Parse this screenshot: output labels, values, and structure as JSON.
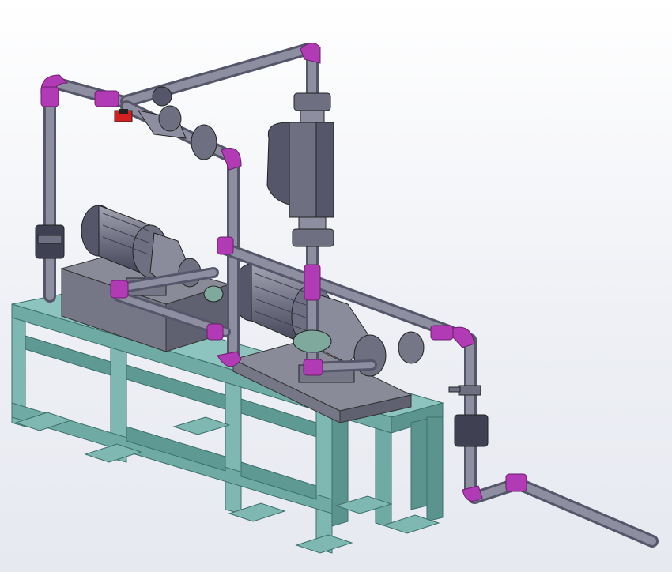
{
  "scene": {
    "colors": {
      "background_top": "#ffffff",
      "background_bottom": "#e6e9f0",
      "frame": "#7fb7b2",
      "frame_shade": "#5e9994",
      "frame_dark": "#4a807b",
      "steel": "#7e7f8e",
      "steel_dark": "#55566a",
      "steel_light": "#a4a5b4",
      "fitting": "#b13ab5",
      "fitting_light": "#d068d3",
      "valve_red": "#d42020"
    },
    "components": [
      "skid-frame",
      "mounting-plate-left",
      "mounting-plate-right",
      "pump-motor-left",
      "pump-motor-right",
      "flow-meter",
      "strainer",
      "check-valve",
      "piping"
    ]
  }
}
